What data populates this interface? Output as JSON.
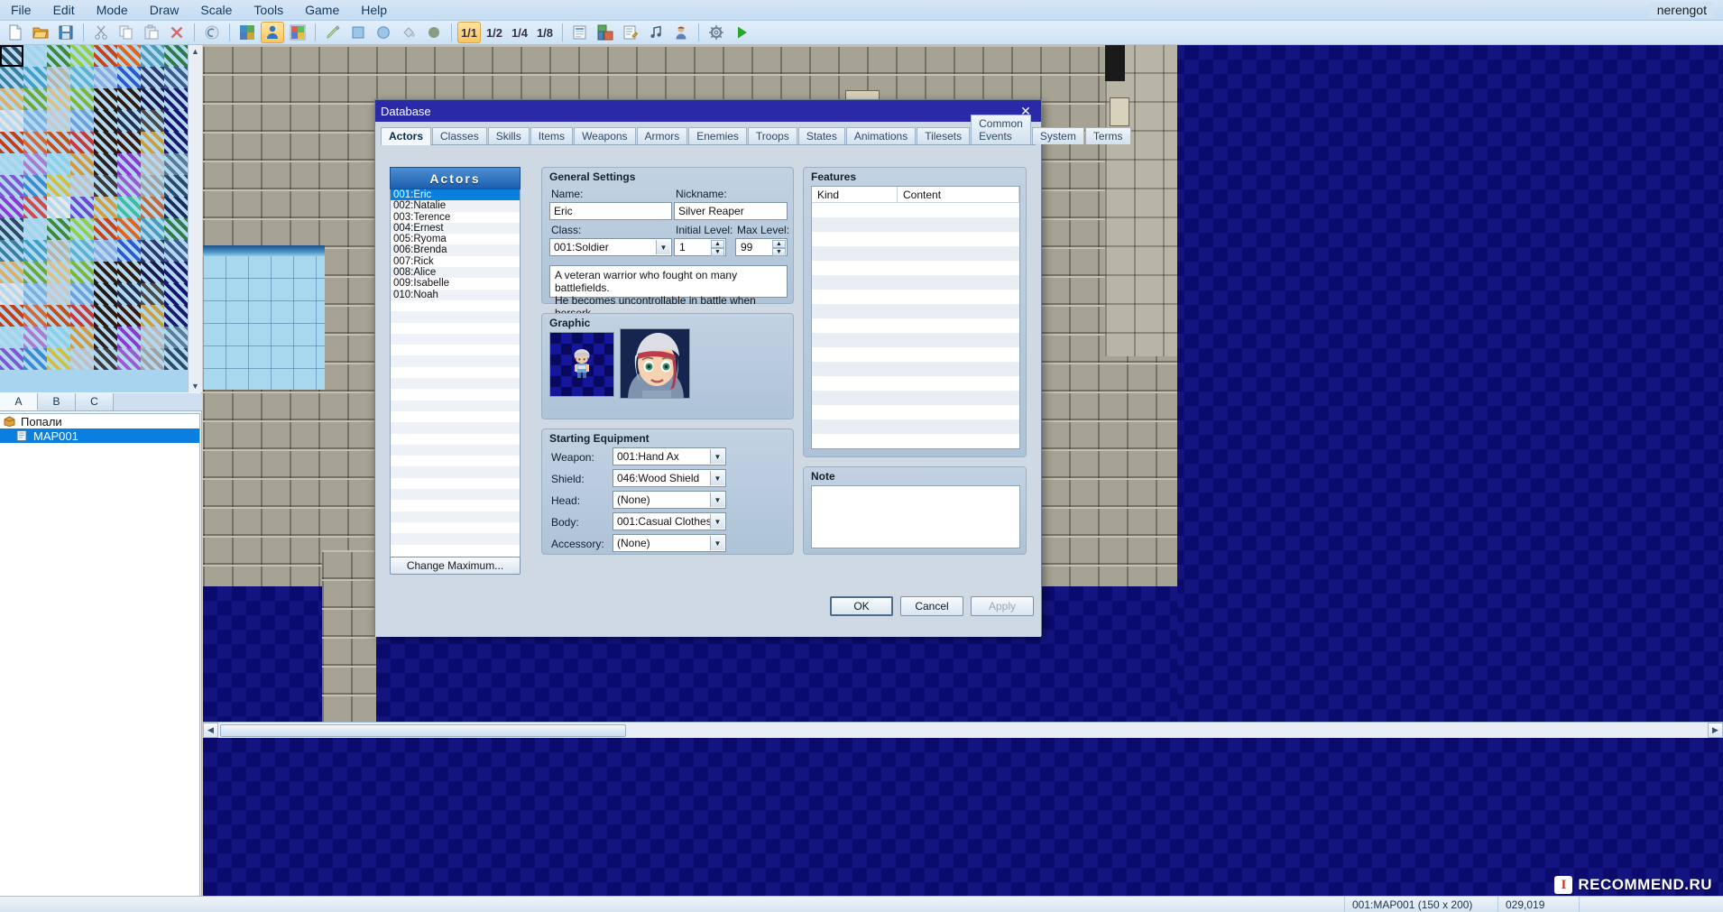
{
  "app": {
    "user": "nerengot",
    "menu": [
      "File",
      "Edit",
      "Mode",
      "Draw",
      "Scale",
      "Tools",
      "Game",
      "Help"
    ]
  },
  "toolbar": {
    "groups": [
      {
        "items": [
          {
            "name": "new-project-icon",
            "glyph": "page"
          },
          {
            "name": "open-project-icon",
            "glyph": "folder"
          },
          {
            "name": "save-project-icon",
            "glyph": "floppy"
          }
        ]
      },
      {
        "items": [
          {
            "name": "cut-icon",
            "glyph": "scissors"
          },
          {
            "name": "copy-icon",
            "glyph": "copy"
          },
          {
            "name": "paste-icon",
            "glyph": "paste"
          },
          {
            "name": "delete-icon",
            "glyph": "x"
          }
        ]
      },
      {
        "items": [
          {
            "name": "undo-icon",
            "glyph": "undo"
          }
        ]
      },
      {
        "items": [
          {
            "name": "map-mode-icon",
            "glyph": "map"
          },
          {
            "name": "event-mode-icon",
            "glyph": "person",
            "active": true
          },
          {
            "name": "region-mode-icon",
            "glyph": "region"
          }
        ]
      },
      {
        "items": [
          {
            "name": "pencil-tool-icon",
            "glyph": "pencil"
          },
          {
            "name": "rectangle-tool-icon",
            "glyph": "square"
          },
          {
            "name": "ellipse-tool-icon",
            "glyph": "circle"
          },
          {
            "name": "flood-fill-tool-icon",
            "glyph": "fill"
          },
          {
            "name": "shadow-pen-icon",
            "glyph": "shadow"
          }
        ]
      },
      {
        "items": [
          {
            "name": "zoom-1-1-icon",
            "glyph": "1/1",
            "active": true
          },
          {
            "name": "zoom-1-2-icon",
            "glyph": "1/2"
          },
          {
            "name": "zoom-1-4-icon",
            "glyph": "1/4"
          },
          {
            "name": "zoom-1-8-icon",
            "glyph": "1/8"
          }
        ]
      },
      {
        "items": [
          {
            "name": "database-icon",
            "glyph": "database"
          },
          {
            "name": "resource-manager-icon",
            "glyph": "resource"
          },
          {
            "name": "script-editor-icon",
            "glyph": "script"
          },
          {
            "name": "sound-test-icon",
            "glyph": "music"
          },
          {
            "name": "character-generator-icon",
            "glyph": "chargen"
          }
        ]
      },
      {
        "items": [
          {
            "name": "playtest-settings-icon",
            "glyph": "gear"
          },
          {
            "name": "playtest-run-icon",
            "glyph": "play"
          }
        ]
      }
    ]
  },
  "left_panel": {
    "palette_tabs": [
      {
        "label": "A",
        "active": true
      },
      {
        "label": "B",
        "active": false
      },
      {
        "label": "C",
        "active": false
      }
    ],
    "tree": [
      {
        "label": "Попали",
        "icon": "project-icon",
        "depth": 0,
        "selected": false
      },
      {
        "label": "MAP001",
        "icon": "map-icon",
        "depth": 1,
        "selected": true
      }
    ]
  },
  "status_bar": {
    "map_info": "001:MAP001 (150 x 200)",
    "coords": "029,019"
  },
  "watermark": {
    "badge": "I",
    "text": "RECOMMEND.RU"
  },
  "dialog": {
    "title": "Database",
    "close_icon": "close-icon",
    "tabs": [
      {
        "label": "Actors",
        "active": true
      },
      {
        "label": "Classes",
        "active": false
      },
      {
        "label": "Skills",
        "active": false
      },
      {
        "label": "Items",
        "active": false
      },
      {
        "label": "Weapons",
        "active": false
      },
      {
        "label": "Armors",
        "active": false
      },
      {
        "label": "Enemies",
        "active": false
      },
      {
        "label": "Troops",
        "active": false
      },
      {
        "label": "States",
        "active": false
      },
      {
        "label": "Animations",
        "active": false
      },
      {
        "label": "Tilesets",
        "active": false
      },
      {
        "label": "Common Events",
        "active": false
      },
      {
        "label": "System",
        "active": false
      },
      {
        "label": "Terms",
        "active": false
      }
    ],
    "actors": {
      "header": "Actors",
      "items": [
        "001:Eric",
        "002:Natalie",
        "003:Terence",
        "004:Ernest",
        "005:Ryoma",
        "006:Brenda",
        "007:Rick",
        "008:Alice",
        "009:Isabelle",
        "010:Noah"
      ],
      "selected_index": 0,
      "change_maximum_label": "Change Maximum..."
    },
    "general_settings": {
      "title": "General Settings",
      "name_label": "Name:",
      "name_value": "Eric",
      "nickname_label": "Nickname:",
      "nickname_value": "Silver Reaper",
      "class_label": "Class:",
      "class_value": "001:Soldier",
      "initial_level_label": "Initial Level:",
      "initial_level_value": "1",
      "max_level_label": "Max Level:",
      "max_level_value": "99",
      "description": "A veteran warrior who fought on many battlefields.\nHe becomes uncontrollable in battle when berserk."
    },
    "graphic": {
      "title": "Graphic",
      "sprite_name": "actor-sprite-preview",
      "face_name": "actor-face-preview"
    },
    "starting_equipment": {
      "title": "Starting Equipment",
      "rows": [
        {
          "label": "Weapon:",
          "value": "001:Hand Ax"
        },
        {
          "label": "Shield:",
          "value": "046:Wood Shield"
        },
        {
          "label": "Head:",
          "value": "(None)"
        },
        {
          "label": "Body:",
          "value": "001:Casual Clothes"
        },
        {
          "label": "Accessory:",
          "value": "(None)"
        }
      ]
    },
    "features": {
      "title": "Features",
      "columns": [
        "Kind",
        "Content"
      ],
      "rows": []
    },
    "note": {
      "title": "Note",
      "value": ""
    },
    "buttons": {
      "ok": "OK",
      "cancel": "Cancel",
      "apply": "Apply"
    }
  },
  "colors": {
    "title_bar": "#2a2aa8",
    "selection": "#0a7fe0",
    "accent_header": "#1d5fae",
    "dialog_bg": "#cfd9e4"
  }
}
